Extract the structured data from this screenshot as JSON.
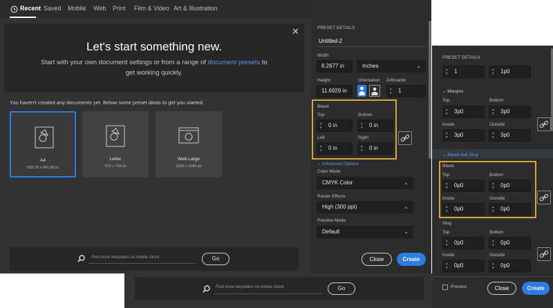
{
  "tabs": [
    {
      "label": "Recent",
      "active": true
    },
    {
      "label": "Saved"
    },
    {
      "label": "Mobile"
    },
    {
      "label": "Web"
    },
    {
      "label": "Print"
    },
    {
      "label": "Film & Video"
    },
    {
      "label": "Art & Illustration"
    }
  ],
  "hero": {
    "title": "Let's start something new.",
    "subtitle_before": "Start with your own document settings or from a range of ",
    "subtitle_link": "document presets",
    "subtitle_after": " to",
    "subtitle_line2": "get working quickly.",
    "close_glyph": "✕"
  },
  "info_text": "You haven't created any documents yet. Below some preset ideas to get you started.",
  "presets": [
    {
      "name": "A4",
      "size": "595.28 x 841.89 pt",
      "icon": "document-icon",
      "selected": true
    },
    {
      "name": "Letter",
      "size": "612 x 792 pt",
      "icon": "document-icon"
    },
    {
      "name": "Web-Large",
      "size": "1920 x 1080 px",
      "icon": "web-icon"
    }
  ],
  "search": {
    "placeholder": "Find more templates on Adobe Stock",
    "go_label": "Go"
  },
  "details": {
    "header": "PRESET DETAILS",
    "name": "Untitled-2",
    "width_label": "Width",
    "width_value": "8.2677 in",
    "unit_value": "Inches",
    "height_label": "Height",
    "height_value": "11.6929 in",
    "orientation_label": "Orientation",
    "artboards_label": "Artboards",
    "artboards_value": "1",
    "bleed_label": "Bleed",
    "top_label": "Top",
    "bottom_label": "Bottom",
    "left_label": "Left",
    "right_label": "Right",
    "bleed_top": "0 in",
    "bleed_bottom": "0 in",
    "bleed_left": "0 in",
    "bleed_right": "0 in",
    "advanced_label": "Advanced Options",
    "color_mode_label": "Color Mode",
    "color_mode_value": "CMYK Color",
    "raster_label": "Raster Effects",
    "raster_value": "High (300 ppi)",
    "preview_mode_label": "Preview Mode",
    "preview_mode_value": "Default",
    "close_label": "Close",
    "create_label": "Create"
  },
  "details2": {
    "header": "PRESET DETAILS",
    "count_value": "1",
    "size_value": "1p0",
    "margins_label": "Margins",
    "top_label": "Top",
    "bottom_label": "Bottom",
    "inside_label": "Inside",
    "outside_label": "Outside",
    "margin_top": "3p0",
    "margin_bottom": "3p0",
    "margin_inside": "3p0",
    "margin_outside": "3p0",
    "bleed_slug_label": "Bleed and Slug",
    "bleed_label": "Bleed",
    "bleed_top": "0p0",
    "bleed_bottom": "0p0",
    "bleed_inside": "0p0",
    "bleed_outside": "0p0",
    "slug_label": "Slug",
    "slug_top": "0p0",
    "slug_bottom": "0p0",
    "slug_inside": "0p0",
    "slug_outside": "0p0",
    "preview_label": "Preview",
    "close_label": "Close",
    "create_label": "Create"
  },
  "colors": {
    "accent": "#2d7be5",
    "highlight": "#d6a73a",
    "panel": "#2c2c2c",
    "background": "#323232"
  }
}
